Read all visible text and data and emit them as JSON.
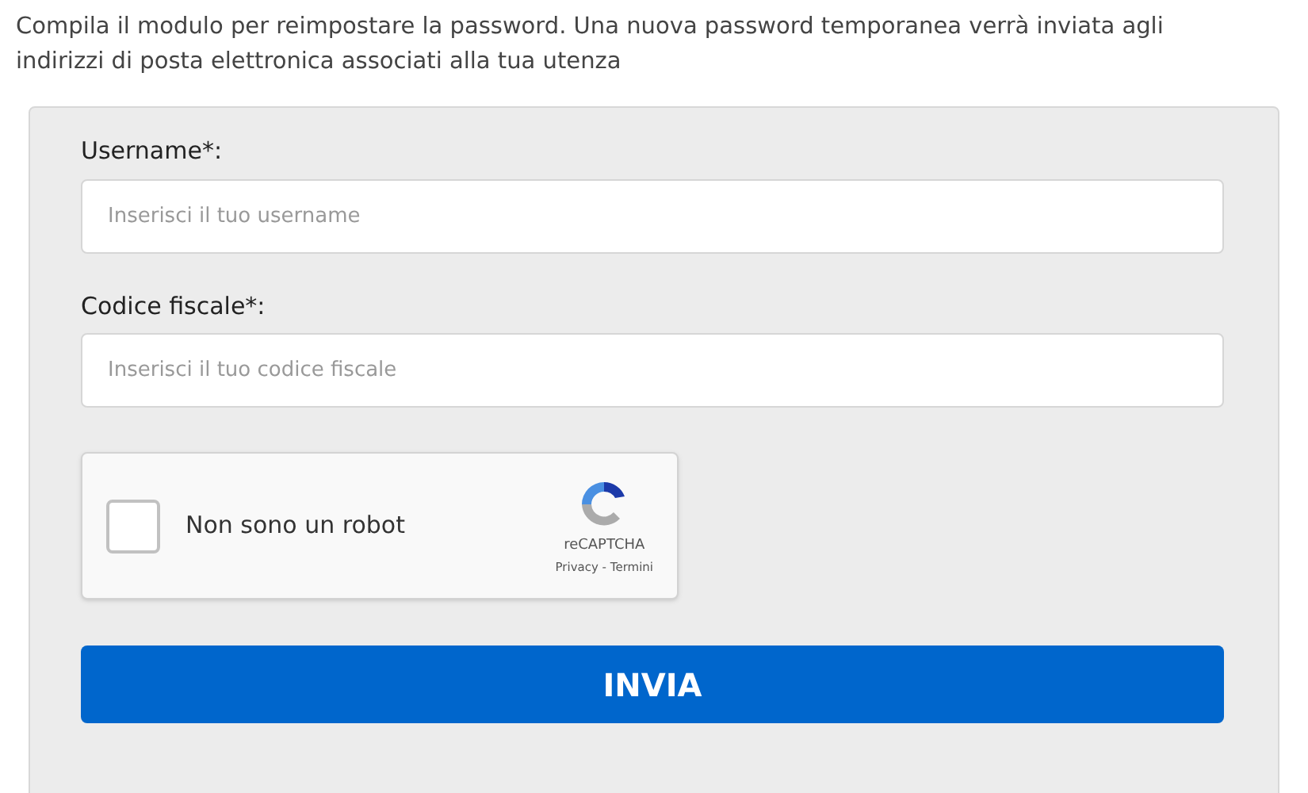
{
  "intro": "Compila il modulo per reimpostare la password. Una nuova password temporanea verrà inviata agli indirizzi di posta elettronica associati alla tua utenza",
  "fields": [
    {
      "label": "Username*:",
      "placeholder": "Inserisci il tuo username"
    },
    {
      "label": "Codice fiscale*:",
      "placeholder": "Inserisci il tuo codice fiscale"
    }
  ],
  "captcha": {
    "label": "Non sono un robot",
    "checked": false,
    "brand": "reCAPTCHA",
    "links": "Privacy - Termini"
  },
  "submit": "INVIA"
}
